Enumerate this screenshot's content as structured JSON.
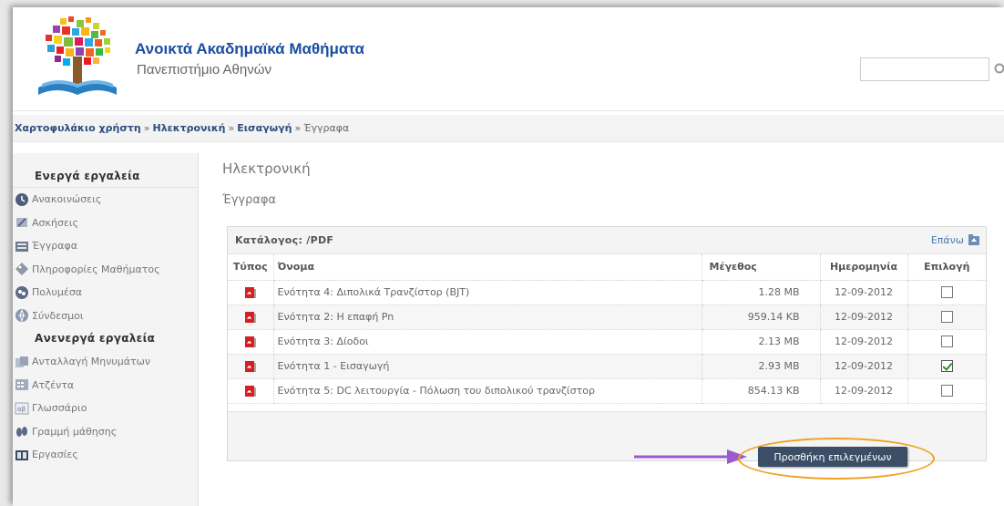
{
  "header": {
    "title": "Ανοικτά Ακαδημαϊκά Μαθήματα",
    "subtitle": "Πανεπιστήμιο Αθηνών",
    "search_placeholder": ""
  },
  "breadcrumb": {
    "items": [
      "Χαρτοφυλάκιο χρήστη",
      "Ηλεκτρονική",
      "Εισαγωγή"
    ],
    "current": "Έγγραφα",
    "separator": "»"
  },
  "sidebar": {
    "active_heading": "Ενεργά εργαλεία",
    "active_items": [
      {
        "label": "Ανακοινώσεις",
        "icon": "announcements-icon"
      },
      {
        "label": "Ασκήσεις",
        "icon": "exercises-icon"
      },
      {
        "label": "Έγγραφα",
        "icon": "documents-icon"
      },
      {
        "label": "Πληροφορίες Μαθήματος",
        "icon": "course-info-icon"
      },
      {
        "label": "Πολυμέσα",
        "icon": "multimedia-icon"
      },
      {
        "label": "Σύνδεσμοι",
        "icon": "links-icon"
      }
    ],
    "inactive_heading": "Ανενεργά εργαλεία",
    "inactive_items": [
      {
        "label": "Ανταλλαγή Μηνυμάτων",
        "icon": "messages-icon"
      },
      {
        "label": "Ατζέντα",
        "icon": "agenda-icon"
      },
      {
        "label": "Γλωσσάριο",
        "icon": "glossary-icon"
      },
      {
        "label": "Γραμμή μάθησης",
        "icon": "learning-path-icon"
      },
      {
        "label": "Εργασίες",
        "icon": "assignments-icon"
      }
    ]
  },
  "main": {
    "title": "Ηλεκτρονική",
    "subtitle": "Έγγραφα",
    "directory_label": "Κατάλογος: /PDF",
    "up_label": "Επάνω",
    "columns": [
      "Τύπος",
      "Όνομα",
      "Μέγεθος",
      "Ημερομηνία",
      "Επιλογή"
    ],
    "files": [
      {
        "name": "Ενότητα 4: Διπολικά Τρανζίστορ (BJT)",
        "size": "1.28 MB",
        "date": "12-09-2012",
        "selected": false
      },
      {
        "name": "Ενότητα 2: Η επαφή Pn",
        "size": "959.14 KB",
        "date": "12-09-2012",
        "selected": false
      },
      {
        "name": "Ενότητα 3: Δίοδοι",
        "size": "2.13 MB",
        "date": "12-09-2012",
        "selected": false
      },
      {
        "name": "Ενότητα 1 - Εισαγωγή",
        "size": "2.93 MB",
        "date": "12-09-2012",
        "selected": true
      },
      {
        "name": "Ενότητα 5: DC λειτουργία - Πόλωση του διπολικού τρανζίστορ",
        "size": "854.13 KB",
        "date": "12-09-2012",
        "selected": false
      }
    ],
    "add_button": "Προσθήκη επιλεγμένων"
  },
  "colors": {
    "title_blue": "#1b4ea0",
    "button_bg": "#3c4e66",
    "highlight_ring": "#f0a020",
    "arrow": "#9a5ad0",
    "pdf_red": "#d42020",
    "check_green": "#2d8a28"
  }
}
